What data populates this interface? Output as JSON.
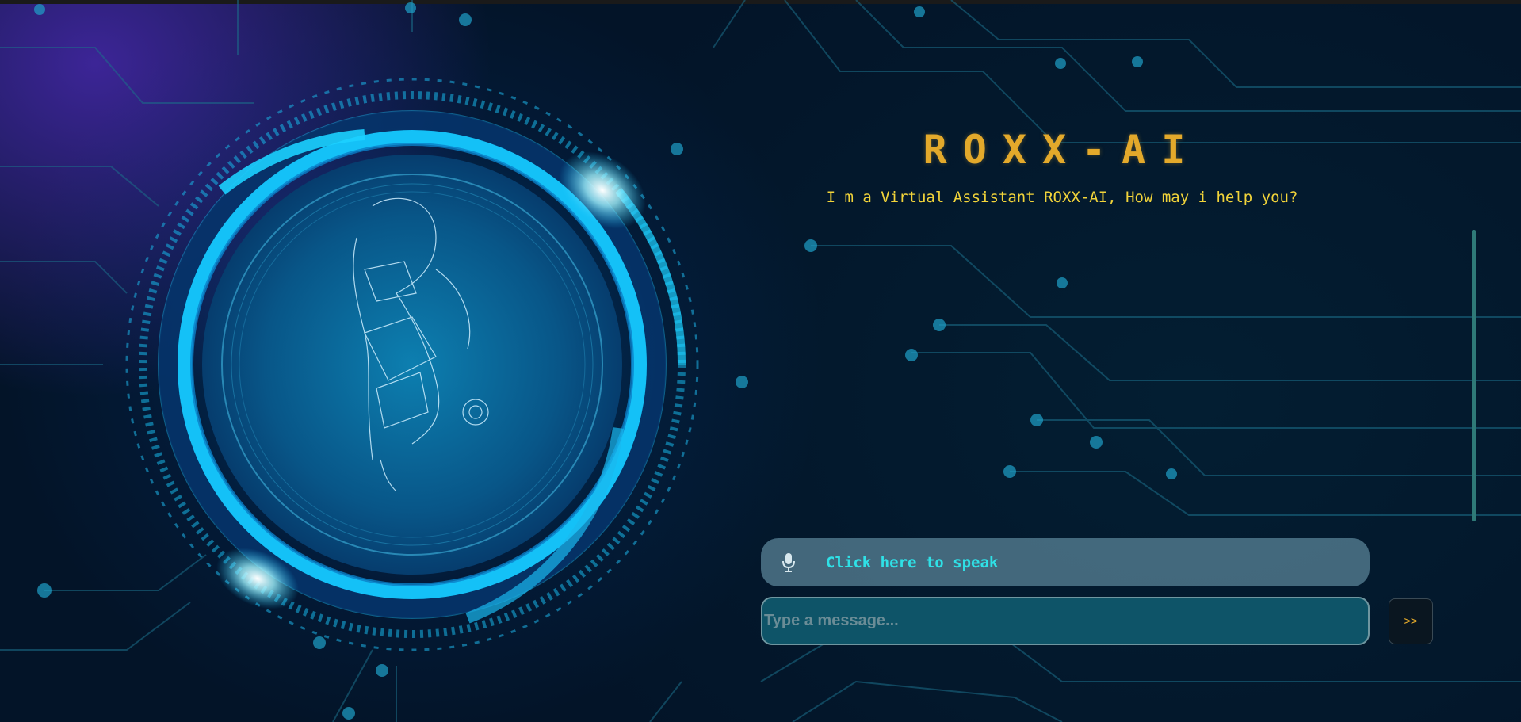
{
  "app": {
    "title": "ROXX-AI",
    "subtitle": "I m a Virtual Assistant ROXX-AI, How may i help you?"
  },
  "voice": {
    "label": "Click here to speak",
    "icon": "microphone-icon"
  },
  "chat": {
    "placeholder": "Type a message...",
    "value": "",
    "send_label": ">>"
  },
  "colors": {
    "title": "#e3a92b",
    "subtitle": "#f2d43a",
    "speak_text": "#2fe0e6",
    "accent_cyan": "#18c8ff",
    "background": "#04121f"
  }
}
